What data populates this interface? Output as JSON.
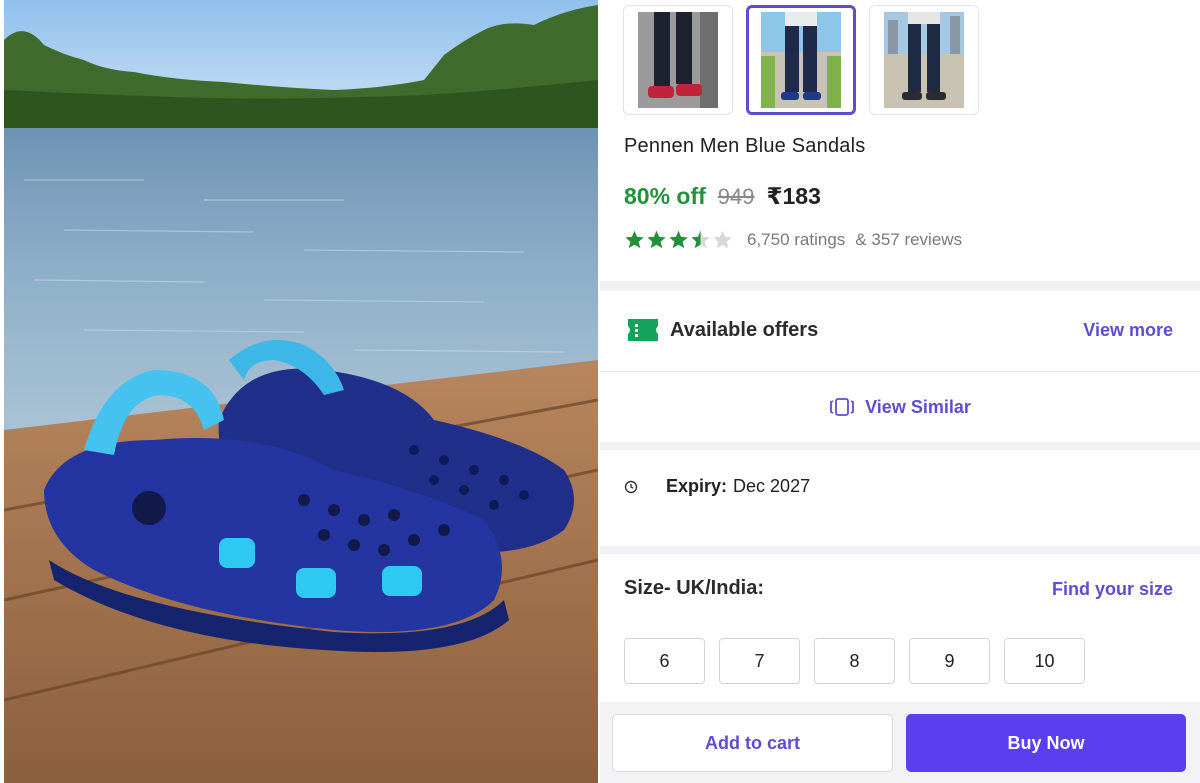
{
  "hero": {
    "image": "blue-clogs-on-dock-photo"
  },
  "gallery": {
    "thumbnails": [
      {
        "name": "thumbnail-1",
        "selected": false
      },
      {
        "name": "thumbnail-2",
        "selected": true
      },
      {
        "name": "thumbnail-3",
        "selected": false
      }
    ]
  },
  "product": {
    "title": "Pennen Men Blue Sandals",
    "discount": "80% off",
    "mrp": "949",
    "price": "₹183",
    "rating_value": 3.5,
    "ratings_count": "6,750 ratings",
    "reviews_count": "& 357 reviews"
  },
  "offers": {
    "title": "Available offers",
    "view_more": "View more",
    "icon": "ticket-icon"
  },
  "similar": {
    "label": "View Similar",
    "icon": "cards-icon"
  },
  "expiry": {
    "label": "Expiry:",
    "value": "Dec 2027",
    "icon": "clock-icon"
  },
  "sizes": {
    "heading": "Size- UK/India:",
    "find_size": "Find your size",
    "options": [
      "6",
      "7",
      "8",
      "9",
      "10"
    ]
  },
  "actions": {
    "add_to_cart": "Add to cart",
    "buy_now": "Buy Now"
  },
  "colors": {
    "accent": "#5b4fcf",
    "buy": "#5b3ef0",
    "discount": "#23913a",
    "star": "#23913a"
  }
}
